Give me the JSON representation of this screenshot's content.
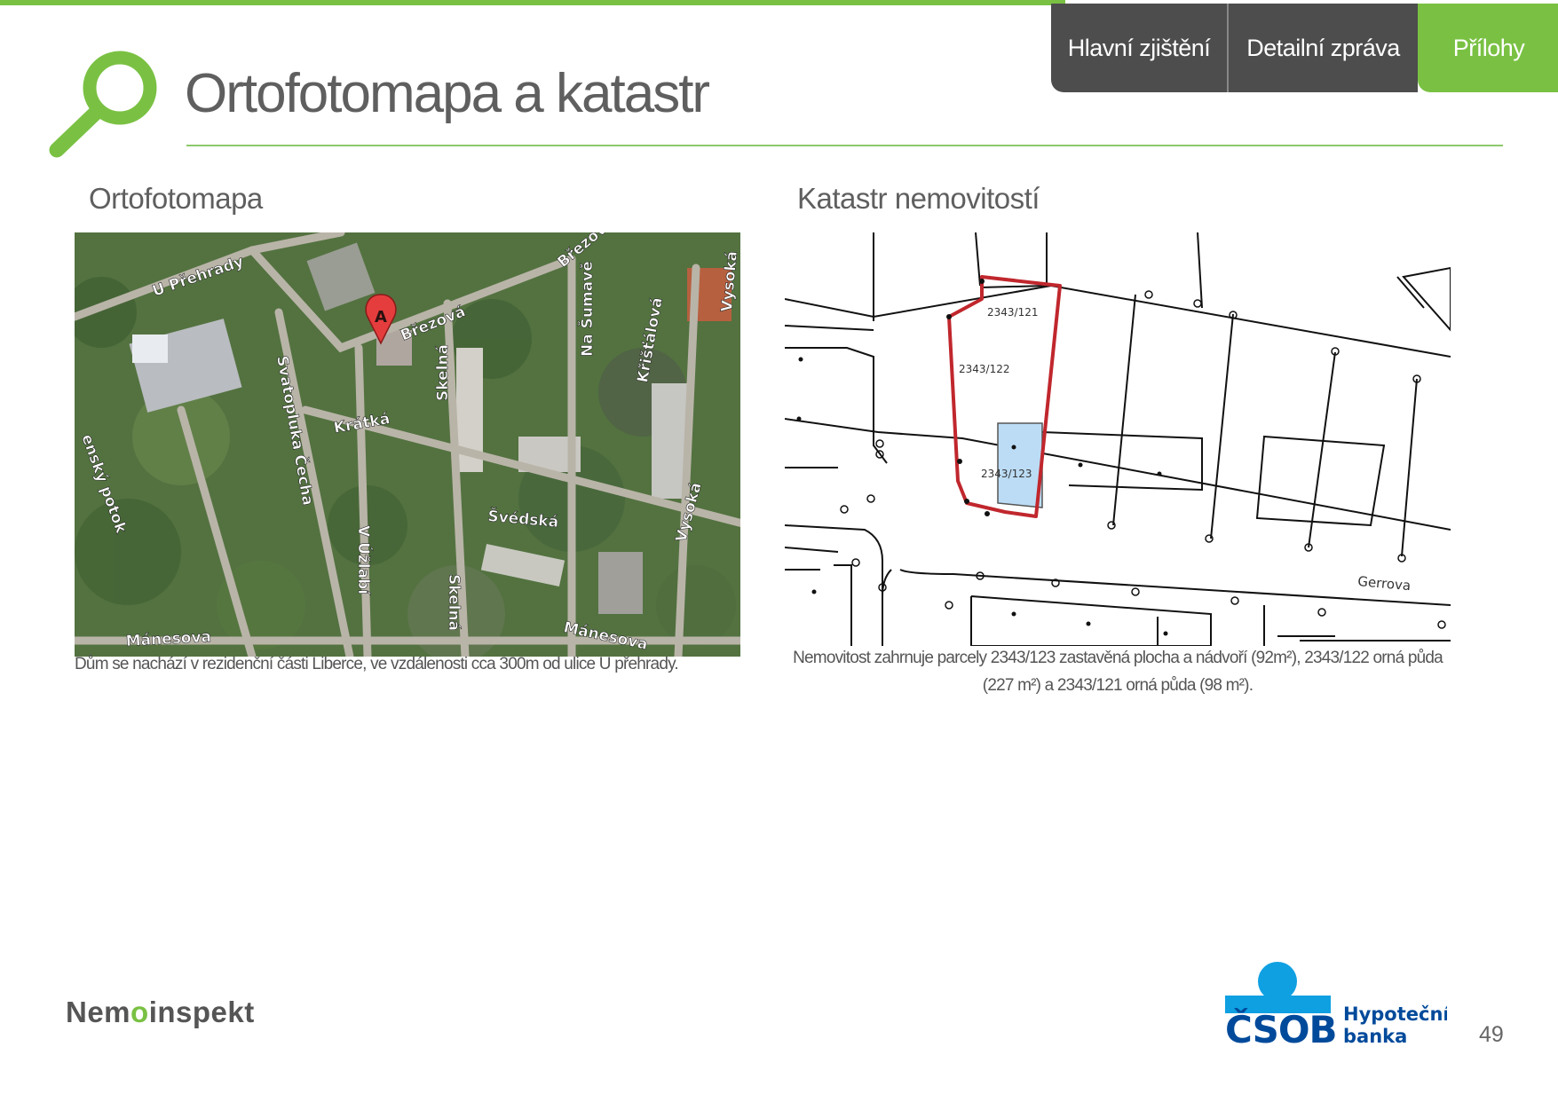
{
  "header": {
    "tabs": [
      {
        "label": "Hlavní zjištění"
      },
      {
        "label": "Detailní zpráva"
      },
      {
        "label": "Přílohy"
      }
    ],
    "title": "Ortofotomapa a katastr"
  },
  "left": {
    "title": "Ortofotomapa",
    "map_labels": [
      "U Přehrady",
      "Březová",
      "Březová",
      "Na Šumavě",
      "Křišťálová",
      "Vysoká",
      "Skelná",
      "Krátká",
      "Svatopluka Čecha",
      "V Úžlabí",
      "Švédská",
      "Vysoká",
      "Skelná",
      "Mánesova",
      "Mánesova",
      "enský potok"
    ],
    "marker": "A",
    "caption": "Dům se nachází v rezidenční části Liberce, ve vzdálenosti cca 300m od ulice U přehrady."
  },
  "right": {
    "title": "Katastr nemovitostí",
    "parcels": [
      "2343/121",
      "2343/122",
      "2343/123"
    ],
    "street": "Gerrova",
    "caption": "Nemovitost zahrnuje parcely 2343/123 zastavěná plocha a nádvoří (92m²), 2343/122 orná půda (227 m²) a 2343/121 orná půda (98 m²)."
  },
  "footer": {
    "logo_left": "Nem",
    "logo_o": "o",
    "logo_right": "inspekt",
    "bank_name": "ČSOB",
    "bank_sub1": "Hypoteční",
    "bank_sub2": "banka",
    "page_number": "49"
  },
  "colors": {
    "accent_green": "#7ac143",
    "tab_dark": "#4d4d4d",
    "boundary_red": "#c0272d",
    "parcel_blue": "#bcdcf5",
    "bank_blue": "#004a9b",
    "bank_light_blue": "#0fa0e2"
  },
  "icons": {
    "logo": "magnifier-icon"
  }
}
